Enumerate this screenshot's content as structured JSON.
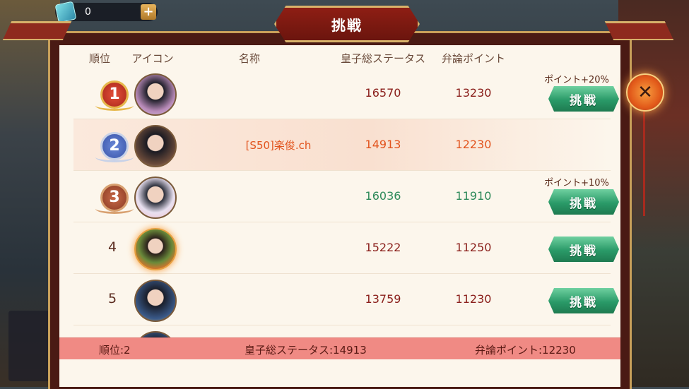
{
  "currency": {
    "amount": "0",
    "plus_label": "+"
  },
  "title": "挑戦",
  "columns": {
    "rank": "順位",
    "icon": "アイコン",
    "name": "名称",
    "status": "皇子総ステータス",
    "points": "弁論ポイント"
  },
  "rows": [
    {
      "rank": "1",
      "name": "",
      "status": "16570",
      "points": "13230",
      "bonus": "ポイント+20%",
      "button": "挑戦"
    },
    {
      "rank": "2",
      "name": "[S50]楽俊.ch",
      "status": "14913",
      "points": "12230",
      "bonus": "",
      "button": ""
    },
    {
      "rank": "3",
      "name": "",
      "status": "16036",
      "points": "11910",
      "bonus": "ポイント+10%",
      "button": "挑戦"
    },
    {
      "rank": "4",
      "name": "",
      "status": "15222",
      "points": "11250",
      "bonus": "",
      "button": "挑戦"
    },
    {
      "rank": "5",
      "name": "",
      "status": "13759",
      "points": "11230",
      "bonus": "",
      "button": "挑戦"
    }
  ],
  "footer": {
    "rank": "順位:2",
    "status": "皇子総ステータス:14913",
    "points": "弁論ポイント:12230"
  },
  "close_label": "✕",
  "colors": {
    "frame": "#4a1a14",
    "panel": "#fcf6ec",
    "footer": "#f08a84",
    "button": "#2a9a68",
    "highlight_text": "#e2541e",
    "green_text": "#2e8a5a"
  }
}
